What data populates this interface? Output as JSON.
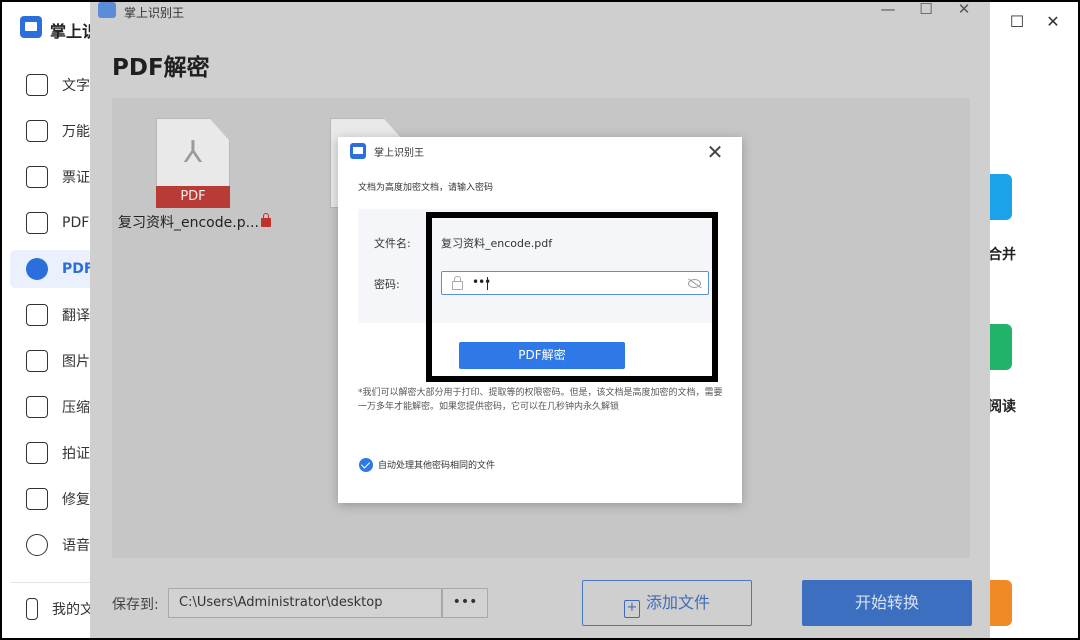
{
  "background_app": {
    "title": "掌上识",
    "sidebar_items": [
      {
        "label": "文字",
        "icon": "text-icon",
        "active": false
      },
      {
        "label": "万能",
        "icon": "scan-icon",
        "active": false
      },
      {
        "label": "票证",
        "icon": "ticket-icon",
        "active": false
      },
      {
        "label": "PDF",
        "icon": "pdf-icon",
        "active": false
      },
      {
        "label": "PDF",
        "icon": "pdf-acrobat-icon",
        "active": true
      },
      {
        "label": "翻译",
        "icon": "translate-icon",
        "active": false
      },
      {
        "label": "图片",
        "icon": "image-icon",
        "active": false
      },
      {
        "label": "压缩",
        "icon": "compress-icon",
        "active": false
      },
      {
        "label": "拍证",
        "icon": "id-photo-icon",
        "active": false
      },
      {
        "label": "修复",
        "icon": "repair-icon",
        "active": false
      },
      {
        "label": "语音",
        "icon": "audio-icon",
        "active": false
      }
    ],
    "sidebar_footer": "我的文",
    "right_tools": [
      {
        "label": "合并",
        "icon": "merge-icon",
        "color": "#1aa3e8"
      },
      {
        "label": "阅读",
        "icon": "read-icon",
        "color": "#22b36b"
      },
      {
        "label": "",
        "icon": "translate-tool-icon",
        "color": "#f08a24"
      }
    ]
  },
  "pdf_window": {
    "titlebar_title": "掌上识别王",
    "heading": "PDF解密",
    "files": [
      {
        "name": "复习资料_encode.p...",
        "band": "PDF",
        "locked": true
      }
    ],
    "save_label": "保存到:",
    "save_path": "C:\\Users\\Administrator\\desktop",
    "more_label": "•••",
    "add_file_label": "添加文件",
    "start_label": "开始转换"
  },
  "dialog": {
    "title": "掌上识别王",
    "close_glyph": "✕",
    "hint": "文档为高度加密文档，请输入密码",
    "filename_label": "文件名:",
    "filename_value": "复习资料_encode.pdf",
    "password_label": "密码:",
    "password_value": "•••",
    "decrypt_button": "PDF解密",
    "note": "*我们可以解密大部分用于打印、提取等的权限密码。但是，该文档是高度加密的文档，需要一万多年才能解密。如果您提供密码，它可以在几秒钟内永久解锁",
    "auto_checkbox_label": "自动处理其他密码相同的文件",
    "auto_checkbox_checked": true
  },
  "colors": {
    "accent": "#2e78e8",
    "pdf_band": "#b93b36",
    "overlay": "#cfcfcf"
  }
}
